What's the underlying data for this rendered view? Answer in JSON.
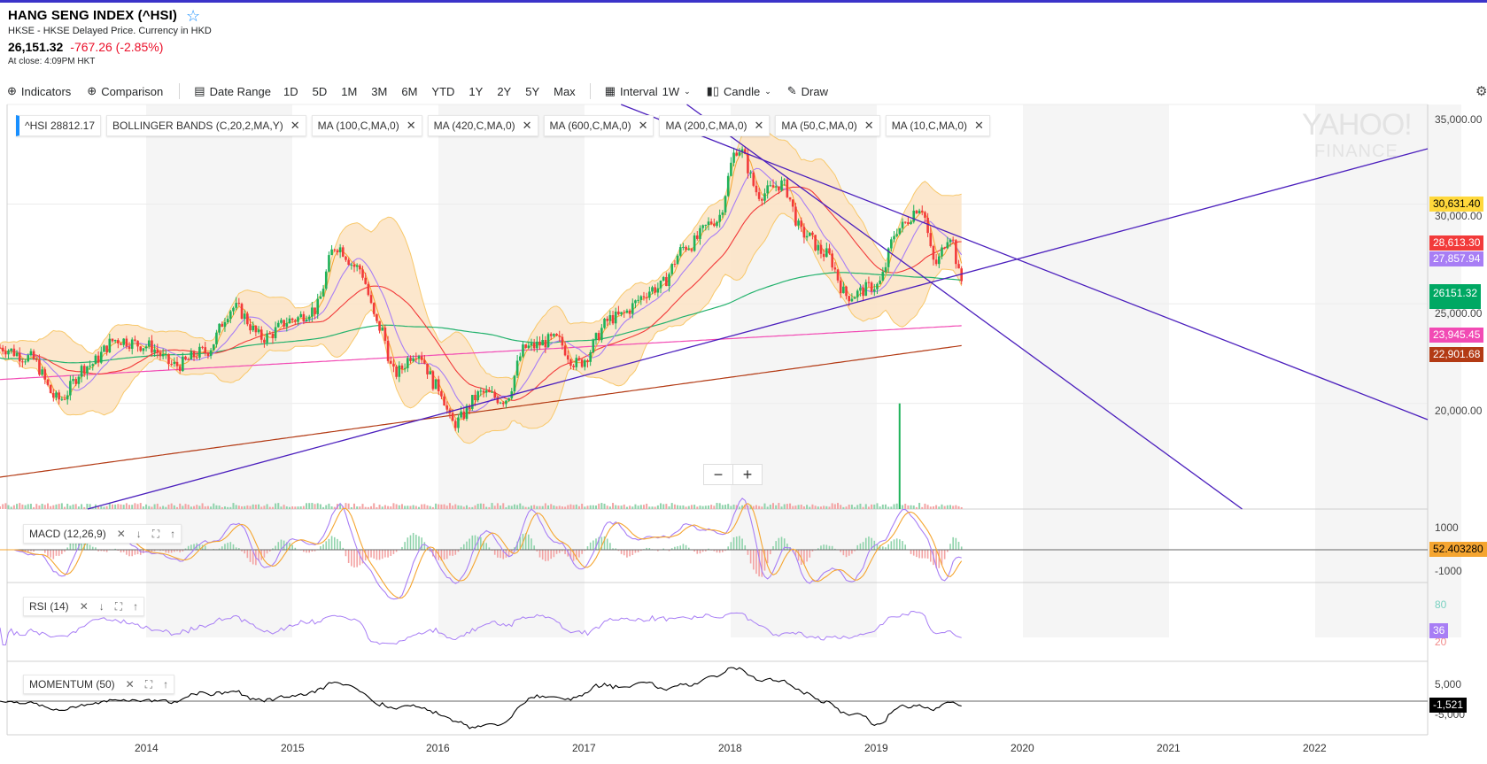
{
  "header": {
    "title": "HANG SENG INDEX (^HSI)",
    "exchange": "HKSE - HKSE Delayed Price. Currency in HKD",
    "price": "26,151.32",
    "change": "-767.26 (-2.85%)",
    "close_time": "At close: 4:09PM HKT"
  },
  "toolbar": {
    "indicators": "Indicators",
    "comparison": "Comparison",
    "date_range": "Date Range",
    "ranges": [
      "1D",
      "5D",
      "1M",
      "3M",
      "6M",
      "YTD",
      "1Y",
      "2Y",
      "5Y",
      "Max"
    ],
    "interval_label": "Interval",
    "interval_value": "1W",
    "chart_type": "Candle",
    "draw": "Draw"
  },
  "studies": [
    {
      "label": "^HSI  28812.17"
    },
    {
      "label": "BOLLINGER BANDS (C,20,2,MA,Y)"
    },
    {
      "label": "MA (100,C,MA,0)"
    },
    {
      "label": "MA (420,C,MA,0)"
    },
    {
      "label": "MA (600,C,MA,0)"
    },
    {
      "label": "MA (200,C,MA,0)"
    },
    {
      "label": "MA (50,C,MA,0)"
    },
    {
      "label": "MA (10,C,MA,0)"
    }
  ],
  "panels": {
    "macd": {
      "label": "MACD (12,26,9)",
      "ticks": [
        "1000",
        "-1000"
      ],
      "value": "52.403280"
    },
    "rsi": {
      "label": "RSI (14)",
      "ticks": [
        "80",
        "20"
      ],
      "value": "36"
    },
    "momentum": {
      "label": "MOMENTUM (50)",
      "ticks": [
        "5,000",
        "-5,000"
      ],
      "value": "-1,521"
    }
  },
  "logo": {
    "line1": "YAHOO!",
    "line2": "FINANCE"
  },
  "zoom": {
    "minus": "−",
    "plus": "+"
  },
  "price_labels": [
    {
      "text": "30,631.40",
      "bg": "#ffd83b",
      "fg": "#000000"
    },
    {
      "text": "28,613.30",
      "bg": "#f23a3a",
      "fg": "#ffffff"
    },
    {
      "text": "27,857.94",
      "bg": "#a87ef5",
      "fg": "#ffffff"
    },
    {
      "text": "26151.32",
      "bg": "#00a863",
      "fg": "#ffffff"
    },
    {
      "text": "23,945.45",
      "bg": "#f24ab4",
      "fg": "#ffffff"
    },
    {
      "text": "22,901.68",
      "bg": "#b33a14",
      "fg": "#ffffff"
    }
  ],
  "colors": {
    "candle_up": "#1fb25a",
    "candle_down": "#f23a3a",
    "bb_fill": "#fce3c4",
    "bb_line": "#f8c86a",
    "ma10": "#f5a530",
    "ma50": "#a87ef5",
    "ma100": "#f23a3a",
    "ma200": "#23b26d",
    "ma420": "#f24ab4",
    "ma600": "#b33a14",
    "trendline": "#4b1fbd"
  },
  "chart_data": {
    "type": "candlestick",
    "title": "HANG SENG INDEX (^HSI)",
    "interval": "1W",
    "x_ticks": [
      "2014",
      "2015",
      "2016",
      "2017",
      "2018",
      "2019",
      "2020",
      "2021",
      "2022"
    ],
    "y_ticks": [
      "35,000.00",
      "30,000.00",
      "25,000.00",
      "20,000.00"
    ],
    "ylim": [
      14700,
      35000
    ],
    "close_series": [
      {
        "t": 2013.0,
        "v": 22800
      },
      {
        "t": 2013.2,
        "v": 22300
      },
      {
        "t": 2013.4,
        "v": 20200
      },
      {
        "t": 2013.6,
        "v": 21900
      },
      {
        "t": 2013.8,
        "v": 23200
      },
      {
        "t": 2014.0,
        "v": 22900
      },
      {
        "t": 2014.2,
        "v": 21900
      },
      {
        "t": 2014.4,
        "v": 22600
      },
      {
        "t": 2014.6,
        "v": 24800
      },
      {
        "t": 2014.8,
        "v": 23300
      },
      {
        "t": 2015.0,
        "v": 24200
      },
      {
        "t": 2015.15,
        "v": 24700
      },
      {
        "t": 2015.3,
        "v": 27900
      },
      {
        "t": 2015.45,
        "v": 26800
      },
      {
        "t": 2015.6,
        "v": 23800
      },
      {
        "t": 2015.7,
        "v": 21500
      },
      {
        "t": 2015.85,
        "v": 22600
      },
      {
        "t": 2016.0,
        "v": 20800
      },
      {
        "t": 2016.1,
        "v": 19000
      },
      {
        "t": 2016.3,
        "v": 20500
      },
      {
        "t": 2016.45,
        "v": 20200
      },
      {
        "t": 2016.6,
        "v": 22800
      },
      {
        "t": 2016.8,
        "v": 23200
      },
      {
        "t": 2016.95,
        "v": 22000
      },
      {
        "t": 2017.2,
        "v": 24300
      },
      {
        "t": 2017.5,
        "v": 25800
      },
      {
        "t": 2017.7,
        "v": 27900
      },
      {
        "t": 2017.9,
        "v": 29200
      },
      {
        "t": 2018.05,
        "v": 32800
      },
      {
        "t": 2018.2,
        "v": 30500
      },
      {
        "t": 2018.35,
        "v": 31000
      },
      {
        "t": 2018.5,
        "v": 28500
      },
      {
        "t": 2018.65,
        "v": 27500
      },
      {
        "t": 2018.8,
        "v": 25400
      },
      {
        "t": 2019.0,
        "v": 25900
      },
      {
        "t": 2019.15,
        "v": 28800
      },
      {
        "t": 2019.3,
        "v": 29900
      },
      {
        "t": 2019.4,
        "v": 27000
      },
      {
        "t": 2019.5,
        "v": 28500
      },
      {
        "t": 2019.58,
        "v": 26151
      }
    ]
  }
}
